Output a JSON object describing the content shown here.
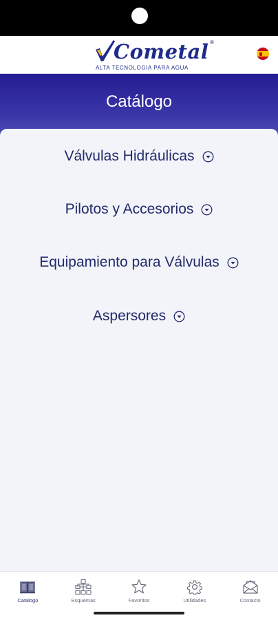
{
  "app": {
    "brand_name": "Cometal",
    "brand_reg": "®",
    "brand_tagline": "ALTA TECNOLOGIA PARA AGUA",
    "language_icon": "spain-flag-icon"
  },
  "header": {
    "title": "Catálogo"
  },
  "catalog": {
    "categories": [
      {
        "label": "Válvulas Hidráulicas",
        "icon": "chevron-down-circle-icon"
      },
      {
        "label": "Pilotos y Accesorios",
        "icon": "chevron-down-circle-icon"
      },
      {
        "label": "Equipamiento para Válvulas",
        "icon": "chevron-down-circle-icon"
      },
      {
        "label": "Aspersores",
        "icon": "chevron-down-circle-icon"
      }
    ]
  },
  "tabbar": {
    "active": "Catalogo",
    "tabs": [
      {
        "label": "Catalogo",
        "icon": "book-icon"
      },
      {
        "label": "Esquemas",
        "icon": "diagram-icon"
      },
      {
        "label": "Favoritos",
        "icon": "star-icon"
      },
      {
        "label": "Utilidades",
        "icon": "gear-icon"
      },
      {
        "label": "Contacto",
        "icon": "mail-icon"
      }
    ]
  },
  "colors": {
    "brand_blue": "#1f2b8c",
    "band_top": "#241c93",
    "band_bottom": "#6f75c3",
    "text_dark": "#232a6a",
    "background": "#f2f4f9"
  }
}
